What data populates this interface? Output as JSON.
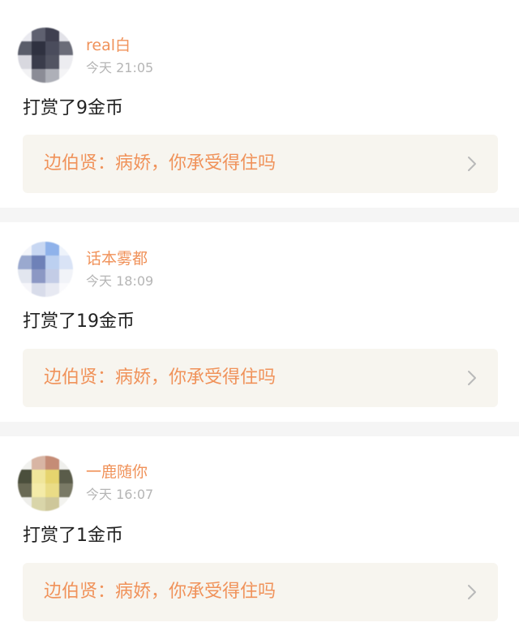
{
  "posts": [
    {
      "username": "real白",
      "timestamp": "今天 21:05",
      "reward_text": "打赏了9金币",
      "book_link": "边伯贤：病娇，你承受得住吗",
      "avatar_colors": [
        "#e9e9ef",
        "#5f6170",
        "#3f4050",
        "#e2e2e8",
        "#5a5d6a",
        "#2f3140",
        "#4a4c5c",
        "#6a6c78",
        "#d8d8df",
        "#3a3c4b",
        "#525462",
        "#ececf0",
        "#f2f2f4",
        "#8b8c96",
        "#aeb0b8",
        "#f4f4f6"
      ]
    },
    {
      "username": "话本雾都",
      "timestamp": "今天 18:09",
      "reward_text": "打赏了19金币",
      "book_link": "边伯贤：病娇，你承受得住吗",
      "avatar_colors": [
        "#f3f5fa",
        "#c8d7f2",
        "#8fb2ea",
        "#eef3fb",
        "#9aa9cf",
        "#6e81b8",
        "#bcd0f0",
        "#d9e3f6",
        "#e2e6ef",
        "#8c98c4",
        "#c3cce6",
        "#f1f3f8",
        "#f6f6fa",
        "#d8dcea",
        "#e7e9f2",
        "#fafafc"
      ]
    },
    {
      "username": "一鹿随你",
      "timestamp": "今天 16:07",
      "reward_text": "打赏了1金币",
      "book_link": "边伯贤：病娇，你承受得住吗",
      "avatar_colors": [
        "#f1f1ee",
        "#d8b5a4",
        "#c58c76",
        "#efefec",
        "#4b4f3c",
        "#f0e69b",
        "#e6d46e",
        "#5a5c4a",
        "#6a6a55",
        "#f4eba8",
        "#eadc86",
        "#7a7a66",
        "#eeeeea",
        "#d9d5a9",
        "#cec79a",
        "#f3f3ef"
      ]
    }
  ],
  "colors": {
    "accent": "#f0925a",
    "timestamp": "#b5b5b5",
    "link_bg": "#f7f5ef",
    "divider": "#f5f5f5",
    "top_indicator": "#f06aa0"
  }
}
